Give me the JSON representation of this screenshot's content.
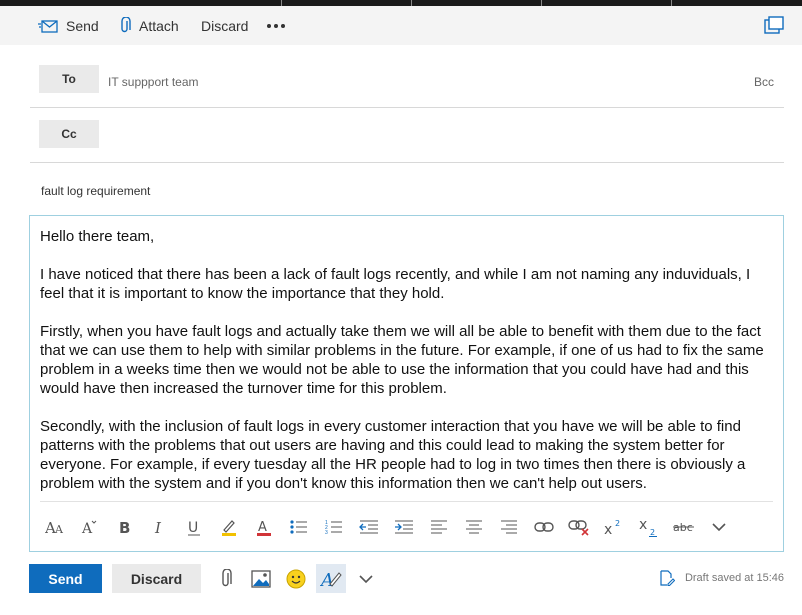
{
  "toolbar": {
    "send_label": "Send",
    "attach_label": "Attach",
    "discard_label": "Discard"
  },
  "recipients": {
    "to_label": "To",
    "to_value": "IT suppport team",
    "bcc_label": "Bcc",
    "cc_label": "Cc"
  },
  "subject": "fault log requirement",
  "body": {
    "greeting": "Hello there team,",
    "paragraph_1": "I have noticed that there has been a lack of fault logs recently, and while I am not naming any induviduals, I feel that it is important to know the importance that they hold.",
    "paragraph_2": "Firstly, when you have fault logs and actually take them we will all be able to benefit with them due to the fact that we can use them to help with similar problems in the future. For example, if one of us had to fix the same problem in a weeks time then we would not be able to use the information that you could have had and this would have then increased the turnover time for this problem.",
    "paragraph_3": "Secondly, with the inclusion of fault logs in every customer interaction that you have we will be able to find patterns with the problems that out users are having and this could lead to making the system better for everyone. For example, if every tuesday all the HR people had to log in two times then there is obviously a problem with the system and if you don't know this information then we can't help out users."
  },
  "footer": {
    "send_label": "Send",
    "discard_label": "Discard",
    "draft_status": "Draft saved at 15:46"
  },
  "colors": {
    "accent": "#0f6cbd",
    "body_border": "#9fd0e0"
  }
}
